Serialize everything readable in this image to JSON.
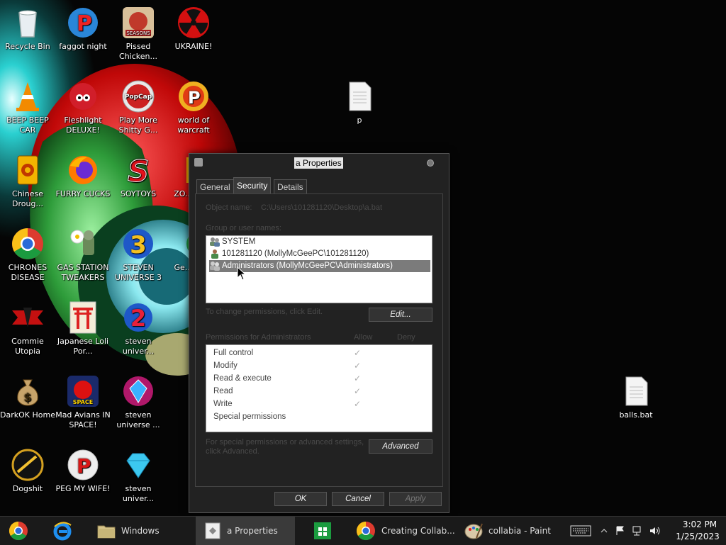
{
  "desktop": {
    "icons": [
      {
        "label": "Recycle Bin"
      },
      {
        "label": "faggot night"
      },
      {
        "label": "Pissed Chicken..."
      },
      {
        "label": "UKRAINE!"
      },
      {
        "label": "BEEP BEEP CAR"
      },
      {
        "label": "Fleshlight DELUXE!"
      },
      {
        "label": "Play More Shitty G..."
      },
      {
        "label": "world of warcraft"
      },
      {
        "label": "Chinese Droug..."
      },
      {
        "label": "FURRY CUCKS"
      },
      {
        "label": "SOYTOYS"
      },
      {
        "label": "ZO... DE..."
      },
      {
        "label": "CHRONES DISEASE"
      },
      {
        "label": "GAS STATION TWEAKERS"
      },
      {
        "label": "STEVEN UNIVERSE 3"
      },
      {
        "label": "Ge... Cri..."
      },
      {
        "label": "Commie Utopia"
      },
      {
        "label": "Japanese Loli Por..."
      },
      {
        "label": "steven univer..."
      },
      {
        "label": "DarkOK Home"
      },
      {
        "label": "Mad Avians IN SPACE!"
      },
      {
        "label": "steven universe ..."
      },
      {
        "label": "Dogshit"
      },
      {
        "label": "PEG MY WIFE!"
      },
      {
        "label": "steven univer..."
      },
      {
        "label": "p"
      },
      {
        "label": "balls.bat"
      }
    ],
    "icon_badge_seasons": "SEASONS",
    "icon_badge_popcap": "PopCap",
    "icon_badge_space": "SPACE"
  },
  "dialog": {
    "title": "a Properties",
    "tabs": [
      "General",
      "Security",
      "Details"
    ],
    "active_tab": "Security",
    "object_name_label": "Object name:",
    "object_name_value": "C:\\Users\\101281120\\Desktop\\a.bat",
    "groups_label": "Group or user names:",
    "groups": [
      {
        "name": "SYSTEM"
      },
      {
        "name": "101281120 (MollyMcGeePC\\101281120)"
      },
      {
        "name": "Administrators (MollyMcGeePC\\Administrators)",
        "selected": true
      }
    ],
    "change_text": "To change permissions, click Edit.",
    "edit_button": "Edit...",
    "permissions_label": "Permissions for Administrators",
    "allow_label": "Allow",
    "deny_label": "Deny",
    "permissions": [
      {
        "name": "Full control",
        "allow": "✓"
      },
      {
        "name": "Modify",
        "allow": "✓"
      },
      {
        "name": "Read & execute",
        "allow": "✓"
      },
      {
        "name": "Read",
        "allow": "✓"
      },
      {
        "name": "Write",
        "allow": "✓"
      },
      {
        "name": "Special permissions",
        "allow": ""
      }
    ],
    "special_text_1": "For special permissions or advanced settings,",
    "special_text_2": "click Advanced.",
    "advanced_button": "Advanced",
    "ok_button": "OK",
    "cancel_button": "Cancel",
    "apply_button": "Apply"
  },
  "taskbar": {
    "items": [
      {
        "label": "Windows"
      },
      {
        "label": "a Properties"
      },
      {
        "label": "Creating Collab..."
      },
      {
        "label": "collabia - Paint"
      }
    ],
    "time": "3:02 PM",
    "date": "1/25/2023"
  }
}
